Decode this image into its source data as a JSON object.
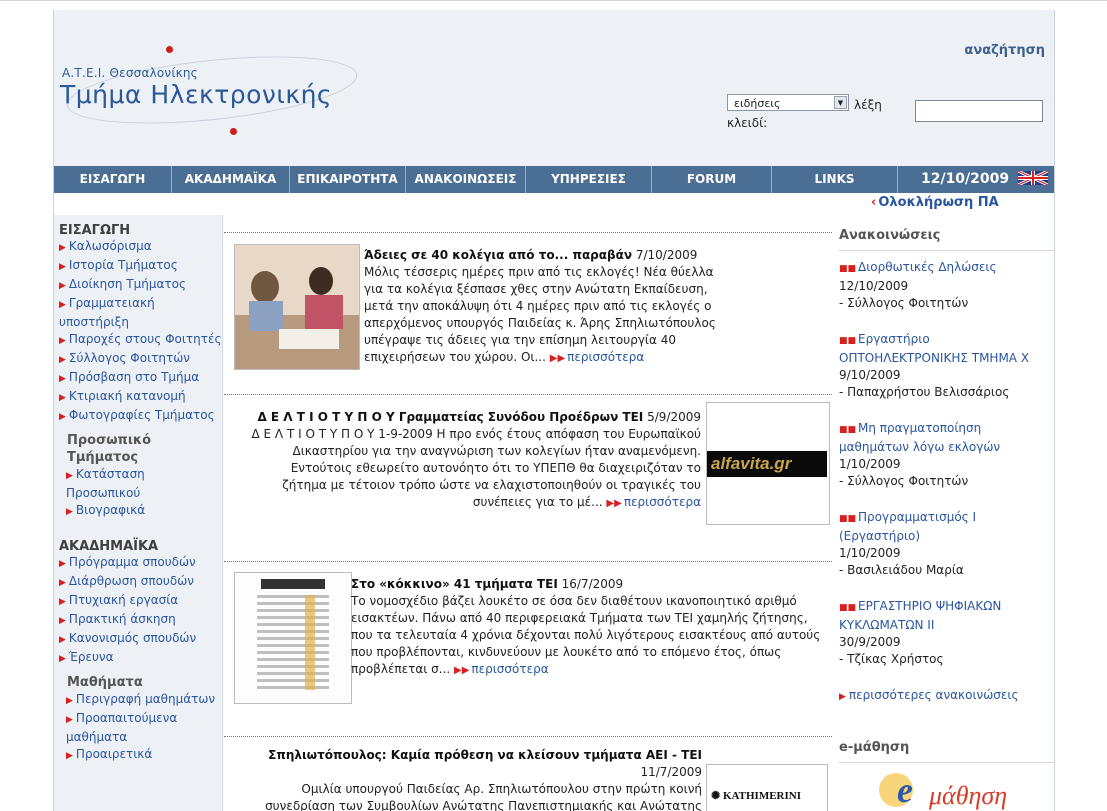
{
  "site": {
    "small_logo": "Α.Τ.Ε.Ι. Θεσσαλονίκης",
    "big_logo": "Τμήμα Ηλεκτρονικής"
  },
  "search": {
    "title": "αναζήτηση",
    "select_value": "ειδήσεις",
    "keyword_label": "λέξη κλειδί:"
  },
  "nav": {
    "items": [
      "ΕΙΣΑΓΩΓΗ",
      "ΑΚΑΔΗΜΑΪΚΑ",
      "ΕΠΙΚΑΙΡΟΤΗΤΑ",
      "ΑΝΑΚΟΙΝΩΣΕΙΣ",
      "ΥΠΗΡΕΣΙΕΣ",
      "FORUM",
      "LINKS"
    ],
    "date": "12/10/2009"
  },
  "ticker": "Ολοκλήρωση ΠΑ",
  "left": {
    "intro_head": "ΕΙΣΑΓΩΓΗ",
    "intro_links": [
      "Καλωσόρισμα",
      "Ιστορία Τμήματος",
      "Διοίκηση Τμήματος",
      "Γραμματειακή υποστήριξη",
      "Παροχές στους Φοιτητές",
      "Σύλλογος Φοιτητών",
      "Πρόσβαση στο Τμήμα",
      "Κτιριακή κατανομή",
      "Φωτογραφίες Τμήματος"
    ],
    "staff_head": "Προσωπικό Τμήματος",
    "staff_links": [
      "Κατάσταση Προσωπικού",
      "Βιογραφικά"
    ],
    "acad_head": "ΑΚΑΔΗΜΑΪΚΑ",
    "acad_links": [
      "Πρόγραμμα σπουδών",
      "Διάρθρωση σπουδών",
      "Πτυχιακή εργασία",
      "Πρακτική άσκηση",
      "Κανονισμός σπουδών",
      "Έρευνα"
    ],
    "courses_head": "Μαθήματα",
    "courses_links": [
      "Περιγραφή μαθημάτων",
      "Προαπαιτούμενα μαθήματα",
      "Προαιρετικά"
    ]
  },
  "articles": [
    {
      "title": "Άδειες σε 40 κολέγια από το... παραβάν",
      "date": "7/10/2009",
      "body": "Μόλις τέσσερις ημέρες πριν από τις εκλογές! Νέα θύελλα για τα κολέγια ξέσπασε χθες στην Ανώτατη Εκπαίδευση, μετά την αποκάλυψη ότι 4 ημέρες πριν από τις εκλογές ο απερχόμενος υπουργός Παιδείας κ. Άρης Σπηλιωτόπουλος υπέγραψε τις άδειες για την επίσημη λειτουργία 40 επιχειρήσεων του χώρου. Οι...",
      "more": "περισσότερα"
    },
    {
      "title": "Δ Ε Λ Τ Ι Ο Τ Υ Π Ο Υ Γραμματείας Συνόδου Προέδρων ΤΕΙ",
      "date": "5/9/2009",
      "body": "Δ Ε Λ Τ Ι Ο Τ Υ Π Ο Υ 1-9-2009 Η προ ενός έτους απόφαση του Ευρωπαϊκού Δικαστηρίου για την αναγνώριση των κολεγίων ήταν αναμενόμενη. Εντούτοις εθεωρείτο αυτονόητο ότι το ΥΠΕΠΘ θα διαχειριζόταν το ζήτημα με τέτοιον τρόπο ώστε να ελαχιστοποιηθούν οι τραγικές του συνέπειες για το μέ...",
      "more": "περισσότερα",
      "logo": "alfavita.gr"
    },
    {
      "title": "Στο «κόκκινο» 41 τμήματα ΤΕΙ",
      "date": "16/7/2009",
      "body": "Το νομοσχέδιο βάζει λουκέτο σε όσα δεν διαθέτουν ικανοποιητικό αριθμό εισακτέων. Πάνω από 40 περιφερειακά Τμήματα των ΤΕΙ χαμηλής ζήτησης, που τα τελευταία 4 χρόνια δέχονται πολύ λιγότερους εισακτέους από αυτούς που προβλέπονται, κινδυνεύουν με λουκέτο από το επόμενο έτος, όπως προβλέπεται σ...",
      "more": "περισσότερα"
    },
    {
      "title": "Σπηλιωτόπουλος: Καμία πρόθεση να κλείσουν τμήματα ΑΕΙ - ΤΕΙ",
      "date": "11/7/2009",
      "body": "Ομιλία υπουργού Παιδείας Αρ. Σπηλιωτόπουλου στην πρώτη κοινή συνεδρίαση των Συμβουλίων Ανώτατης Πανεπιστημιακής και Ανώτατης",
      "logo": "KATHIMERINI"
    }
  ],
  "right": {
    "ann_head": "Ανακοινώσεις",
    "announcements": [
      {
        "title": "Διορθωτικές Δηλώσεις",
        "date": "12/10/2009",
        "author": "- Σύλλογος Φοιτητών"
      },
      {
        "title": "Εργαστήριο ΟΠΤΟΗΛΕΚΤΡΟΝΙΚΗΣ ΤΜΗΜΑ Χ",
        "date": "9/10/2009",
        "author": "- Παπαχρήστου Βελισσάριος"
      },
      {
        "title": "Μη πραγματοποίηση μαθημάτων λόγω εκλογών",
        "date": "1/10/2009",
        "author": "- Σύλλογος Φοιτητών"
      },
      {
        "title": "Προγραμματισμός Ι (Εργαστήριο)",
        "date": "1/10/2009",
        "author": "- Βασιλειάδου Μαρία"
      },
      {
        "title": "ΕΡΓΑΣΤΗΡΙΟ ΨΗΦΙΑΚΩΝ ΚΥΚΛΩΜΑΤΩΝ ΙΙ",
        "date": "30/9/2009",
        "author": "- Τζίκας Χρήστος"
      }
    ],
    "more_ann": "περισσότερες ανακοινώσεις",
    "elearn_head": "e-μάθηση",
    "elearn_logo": "μάθηση"
  }
}
